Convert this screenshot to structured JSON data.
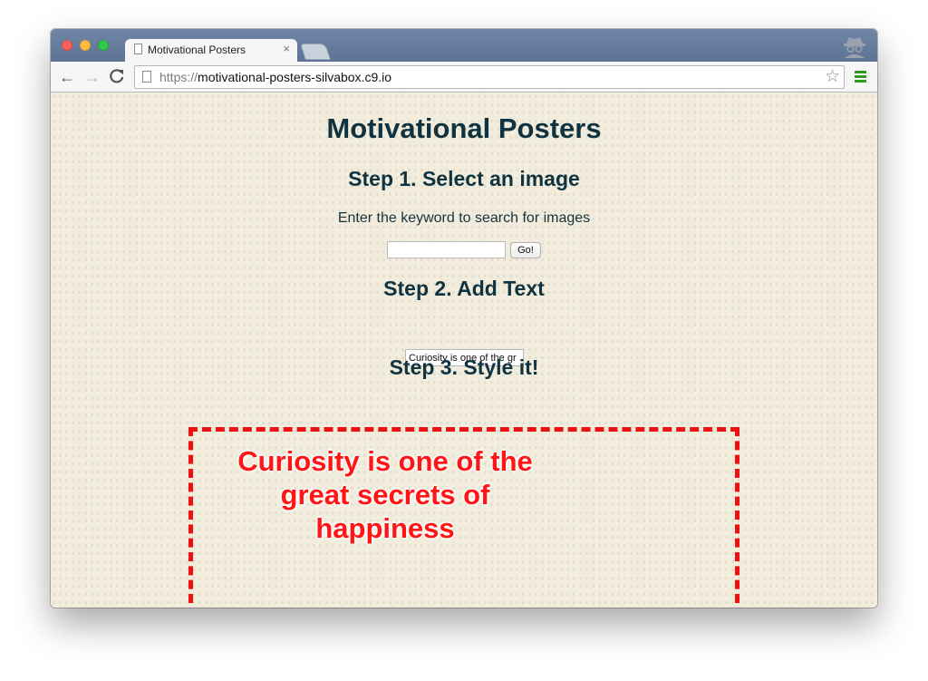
{
  "browser": {
    "tab": {
      "title": "Motivational Posters",
      "close_glyph": "×"
    },
    "nav": {
      "back_glyph": "←",
      "forward_glyph": "→",
      "reload_glyph": "C"
    },
    "address_bar": {
      "scheme": "https://",
      "host": "motivational-posters-silvabox.c9.io",
      "bookmark_glyph": "☆"
    },
    "icons": [
      "page-icon",
      "incognito-icon",
      "menu-icon",
      "bookmark-star-icon"
    ]
  },
  "page": {
    "title": "Motivational Posters",
    "step1": {
      "heading": "Step 1. Select an image",
      "instruction": "Enter the keyword to search for images",
      "search_value": "",
      "go_label": "Go!"
    },
    "step2": {
      "heading": "Step 2. Add Text",
      "text_value": "Curiosity is one of the gr"
    },
    "step3": {
      "heading": "Step 3. Style it!"
    },
    "poster": {
      "caption": "Curiosity is one of the great secrets of happiness"
    }
  },
  "colors": {
    "heading": "#0f3340",
    "page_background": "#f1ecdc",
    "poster_border": "#ee1111",
    "caption_text": "#ff1515",
    "menu_icon": "#2e9a1e"
  }
}
